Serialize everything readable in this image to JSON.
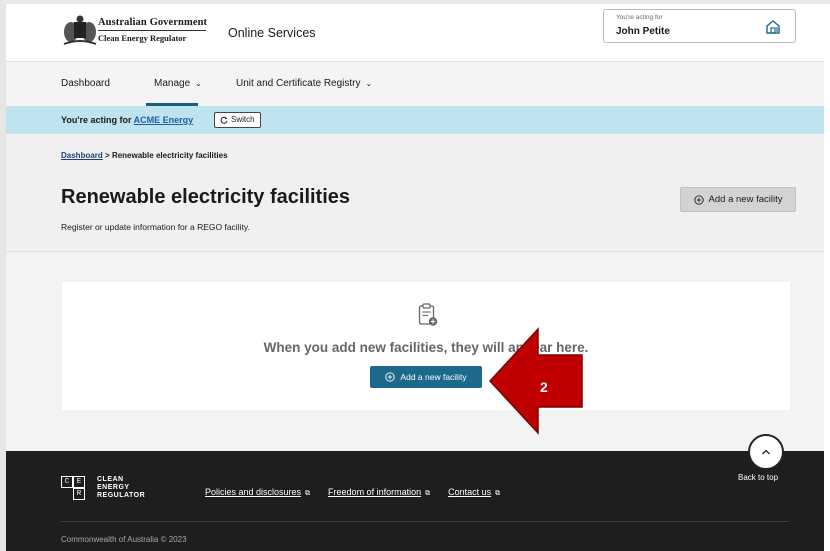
{
  "header": {
    "gov_line1": "Australian Government",
    "gov_line2": "Clean Energy Regulator",
    "service_title": "Online Services",
    "acting_for_label": "You're acting for",
    "acting_for_name": "John Petite",
    "acting_icon": "building-icon"
  },
  "nav": {
    "items": [
      {
        "label": "Dashboard",
        "has_menu": false
      },
      {
        "label": "Manage",
        "has_menu": true,
        "active": true
      },
      {
        "label": "Unit and Certificate Registry",
        "has_menu": true
      }
    ],
    "chevron": "⌄"
  },
  "acting_bar": {
    "prefix": "You're acting for",
    "org": "ACME Energy",
    "switch_label": "Switch"
  },
  "breadcrumb": {
    "home": "Dashboard",
    "separator": ">",
    "current": "Renewable electricity facilities"
  },
  "page": {
    "title": "Renewable electricity facilities",
    "subtitle": "Register or update information for a REGO facility.",
    "add_button": "Add a new facility"
  },
  "empty_state": {
    "message": "When you add new facilities, they will appear here.",
    "add_button": "Add a new facility"
  },
  "annotation": {
    "step_number": "2",
    "color": "#c00000"
  },
  "back_to_top": {
    "label": "Back to top"
  },
  "footer": {
    "logo_letters": [
      "C",
      "E",
      "R"
    ],
    "logo_text": [
      "CLEAN",
      "ENERGY",
      "REGULATOR"
    ],
    "links": [
      "Policies and disclosures",
      "Freedom of information",
      "Contact us"
    ],
    "copyright": "Commonwealth of Australia © 2023"
  },
  "colors": {
    "primary": "#1b6a8c",
    "acting_bar": "#bfe3ef",
    "footer_bg": "#1e1e1e"
  }
}
